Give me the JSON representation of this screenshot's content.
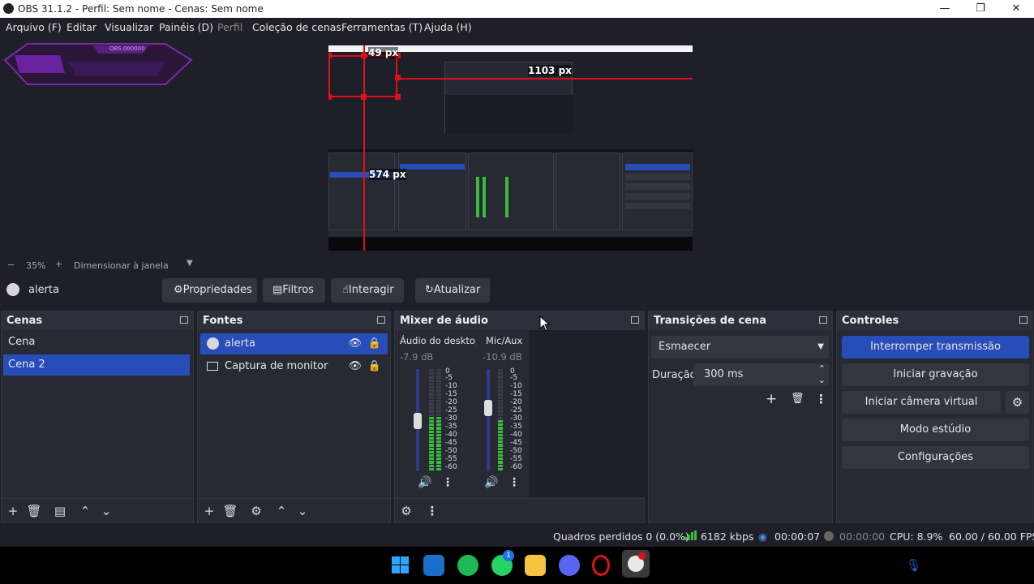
{
  "window": {
    "title": "OBS 31.1.2 - Perfil: Sem nome - Cenas: Sem nome",
    "minimize": "—",
    "maximize": "❐",
    "close": "✕"
  },
  "menu": [
    "Arquivo (F)",
    "Editar",
    "Visualizar",
    "Painéis (D)",
    "Perfil",
    "Coleção de cenas",
    "Ferramentas (T)",
    "Ajuda (H)"
  ],
  "preview": {
    "badge_text": "OBS 000000",
    "labels": {
      "top": "49 px",
      "right": "1103 px",
      "left": "574 px"
    }
  },
  "zoom": {
    "minus": "−",
    "value": "35%",
    "plus": "+",
    "mode": "Dimensionar à janela"
  },
  "source_toolbar": {
    "selected_source": "alerta",
    "buttons": [
      "Propriedades",
      "Filtros",
      "Interagir",
      "Atualizar"
    ]
  },
  "scenes": {
    "title": "Cenas",
    "items": [
      "Cena",
      "Cena 2"
    ],
    "selected": "Cena 2"
  },
  "sources": {
    "title": "Fontes",
    "items": [
      {
        "name": "alerta",
        "icon": "globe-icon",
        "selected": true
      },
      {
        "name": "Captura de monitor",
        "icon": "monitor-icon",
        "selected": false
      }
    ]
  },
  "mixer": {
    "title": "Mixer de áudio",
    "channels": [
      {
        "name": "Áudio do desktop",
        "db": "-7.9 dB",
        "level": 0.55
      },
      {
        "name": "Mic/Aux",
        "db": "-10.9 dB",
        "level": 0.5
      }
    ],
    "scale": [
      "0",
      "-5",
      "-10",
      "-15",
      "-20",
      "-25",
      "-30",
      "-35",
      "-40",
      "-45",
      "-50",
      "-55",
      "-60"
    ]
  },
  "transitions": {
    "title": "Transições de cena",
    "selected": "Esmaecer",
    "duration_label": "Duração",
    "duration_value": "300 ms"
  },
  "controls": {
    "title": "Controles",
    "buttons": [
      "Interromper transmissão",
      "Iniciar gravação",
      "Iniciar câmera virtual",
      "Modo estúdio",
      "Configurações"
    ]
  },
  "status": {
    "dropped": "Quadros perdidos 0 (0.0%)",
    "bitrate": "6182 kbps",
    "stream_time": "00:00:07",
    "rec_time": "00:00:00",
    "cpu": "CPU: 8.9%",
    "fps": "60.00 / 60.00 FPS"
  },
  "taskbar": {
    "whatsapp_badge": "1"
  },
  "colors": {
    "accent": "#284cb8",
    "bg": "#1e1f29",
    "dock": "#272a33",
    "guide": "#e0101a",
    "meter_green": "#3cba3c",
    "meter_yellow": "#c8b420",
    "meter_red": "#c02020"
  }
}
